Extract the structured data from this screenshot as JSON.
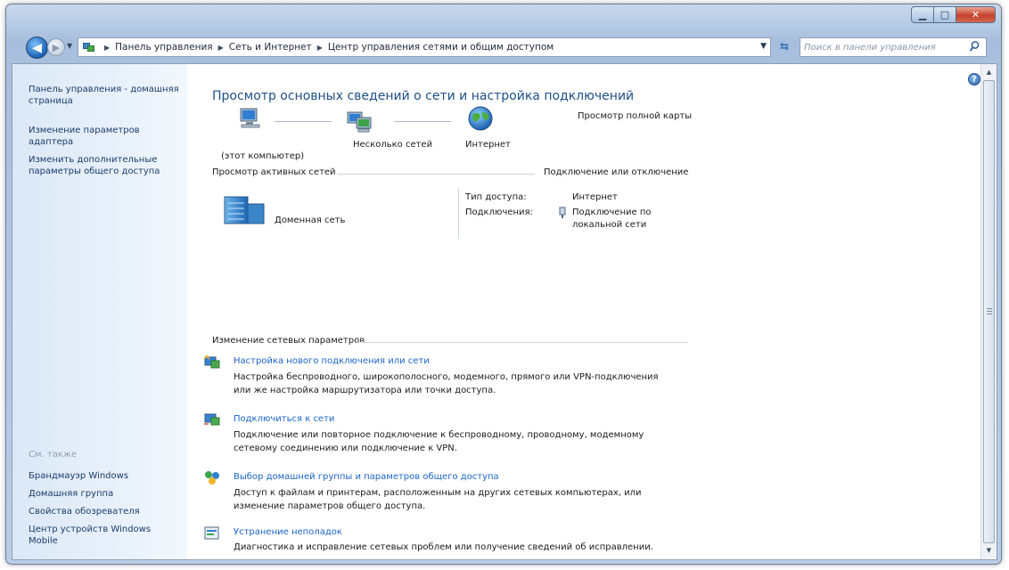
{
  "window": {
    "controls": {
      "minimize": "▁",
      "maximize": "□",
      "close": "✕"
    }
  },
  "address_bar": {
    "breadcrumbs": [
      "Панель управления",
      "Сеть и Интернет",
      "Центр управления сетями и общим доступом"
    ],
    "search_placeholder": "Поиск в панели управления"
  },
  "sidebar": {
    "links": [
      "Панель управления - домашняя страница",
      "Изменение параметров адаптера",
      "Изменить дополнительные параметры общего доступа"
    ],
    "see_also_label": "См. также",
    "see_also_links": [
      "Брандмауэр Windows",
      "Домашняя группа",
      "Свойства обозревателя",
      "Центр устройств Windows Mobile"
    ]
  },
  "main": {
    "title": "Просмотр основных сведений о сети и настройка подключений",
    "full_map_link": "Просмотр полной карты",
    "network_map": {
      "computer_label": "(этот компьютер)",
      "networks_label": "Несколько сетей",
      "internet_label": "Интернет"
    },
    "active_networks": {
      "heading": "Просмотр активных сетей",
      "connect_link": "Подключение или отключение",
      "network_name": "Доменная сеть",
      "access_type_label": "Тип доступа:",
      "access_type_value": "Интернет",
      "connections_label": "Подключения:",
      "connection_link_line1": "Подключение по",
      "connection_link_line2": "локальной сети"
    },
    "change_settings": {
      "heading": "Изменение сетевых параметров",
      "tasks": [
        {
          "title": "Настройка нового подключения или сети",
          "desc_line1": "Настройка беспроводного, широкополосного, модемного, прямого или VPN-подключения",
          "desc_line2": "или же настройка маршрутизатора или точки доступа.",
          "icon": "new-connection-icon"
        },
        {
          "title": "Подключиться к сети",
          "desc_line1": "Подключение или повторное подключение к беспроводному, проводному, модемному",
          "desc_line2": "сетевому соединению или подключение к VPN.",
          "icon": "connect-network-icon"
        },
        {
          "title": "Выбор домашней группы и параметров общего доступа",
          "desc_line1": "Доступ к файлам и принтерам, расположенным на других сетевых компьютерах, или",
          "desc_line2": "изменение параметров общего доступа.",
          "icon": "homegroup-icon"
        },
        {
          "title": "Устранение неполадок",
          "desc_line1": "Диагностика и исправление сетевых проблем или получение сведений об исправлении.",
          "desc_line2": "",
          "icon": "troubleshoot-icon"
        }
      ]
    }
  },
  "colors": {
    "link": "#1c64c7",
    "title": "#1e4f86",
    "sidebar_link": "#1a3c6a",
    "see_also": "#8ea0b4"
  }
}
